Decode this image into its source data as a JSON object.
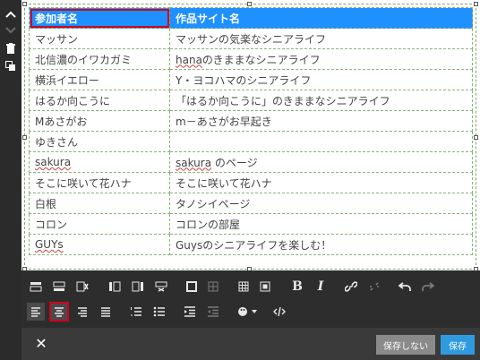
{
  "table": {
    "header": [
      "参加者名",
      "作品サイト名"
    ],
    "rows": [
      [
        "マッサン",
        "マッサンの気楽なシニアライフ"
      ],
      [
        "北信濃のイワカガミ",
        "hanaのきままなシニアライフ"
      ],
      [
        "横浜イエロー",
        "Y・ヨコハマのシニアライフ"
      ],
      [
        "はるか向こうに",
        "「はるか向こうに」のきままなシニアライフ"
      ],
      [
        "Mあさがお",
        "m－あさがお早起き"
      ],
      [
        "ゆきさん",
        ""
      ],
      [
        "sakura",
        "sakura のページ"
      ],
      [
        "そこに咲いて花ハナ",
        "そこに咲いて花ハナ"
      ],
      [
        "白根",
        "タノシイページ"
      ],
      [
        "コロン",
        "コロンの部屋"
      ],
      [
        "GUYs",
        "Guysのシニアライフを楽しむ！"
      ]
    ]
  },
  "toolbar": {
    "row1": [
      "insert-row-above-icon",
      "insert-row-below-icon",
      "delete-row-icon",
      "insert-col-left-icon",
      "insert-col-right-icon",
      "delete-col-icon",
      "cell-border-icon",
      "merge-cells-icon",
      "table-icon",
      "table-props-icon",
      "bold-icon",
      "italic-icon",
      "link-icon",
      "unlink-icon",
      "undo-icon",
      "redo-icon"
    ],
    "row2": [
      "align-left-icon",
      "align-center-icon",
      "align-right-icon",
      "align-justify-icon",
      "ordered-list-icon",
      "unordered-list-icon",
      "indent-icon",
      "outdent-icon",
      "color-icon",
      "code-icon"
    ],
    "bold_glyph": "B",
    "italic_glyph": "I"
  },
  "footer": {
    "close_glyph": "✕",
    "nosave_label": "保存しない",
    "save_label": "保存"
  },
  "colors": {
    "header_bg": "#1e90ff",
    "selection_outline": "#d0021b",
    "save_button": "#2e9be0",
    "nosave_button": "#8a8a8a",
    "toolbar_bg": "#2d2d2d"
  }
}
